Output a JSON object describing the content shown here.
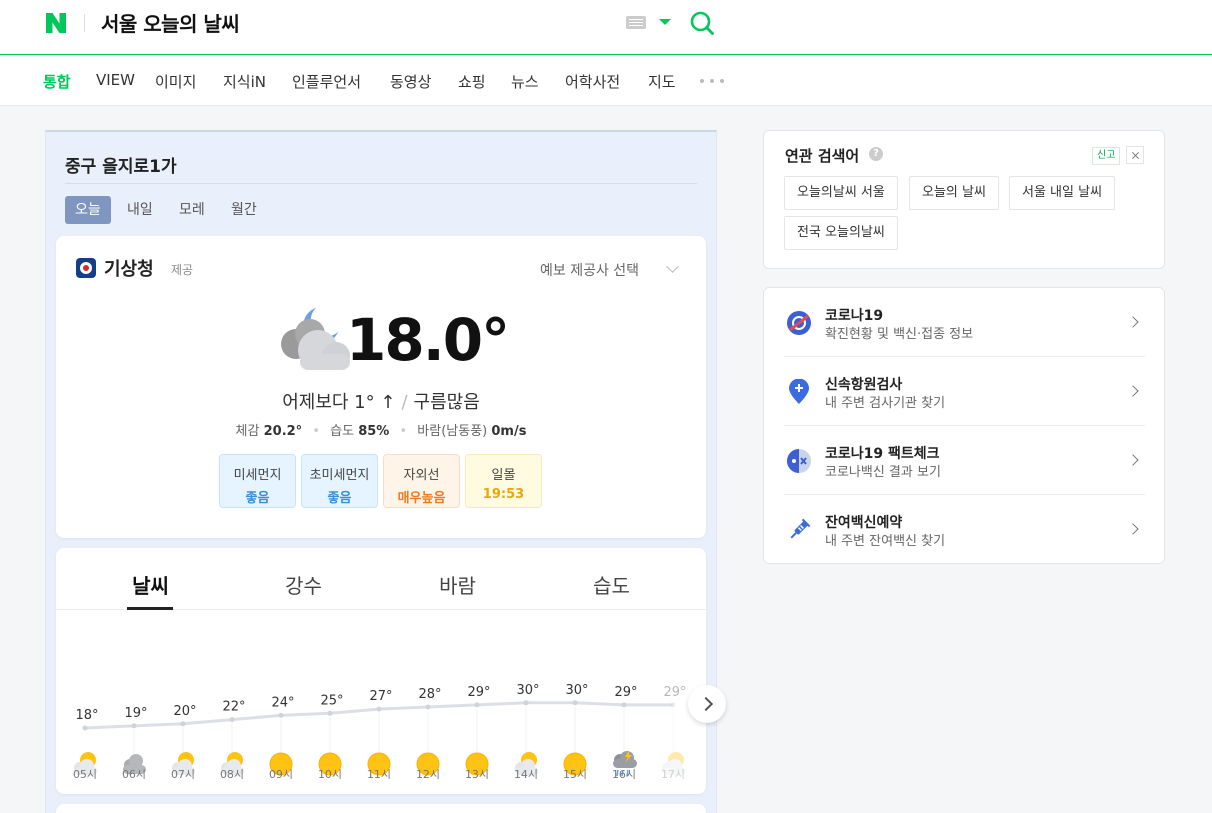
{
  "header": {
    "query": "서울 오늘의 날씨"
  },
  "nav": {
    "items": [
      "통합",
      "VIEW",
      "이미지",
      "지식iN",
      "인플루언서",
      "동영상",
      "쇼핑",
      "뉴스",
      "어학사전",
      "지도"
    ],
    "active_index": 0
  },
  "weather": {
    "location": "중구 을지로1가",
    "day_tabs": [
      "오늘",
      "내일",
      "모레",
      "월간"
    ],
    "active_day_index": 0,
    "provider": "기상청",
    "provider_sub": "제공",
    "provider_select": "예보 제공사 선택",
    "current_icon": "cloudy-night-icon",
    "temperature": "18.0°",
    "compare": "어제보다 1° ↑",
    "condition": "구름많음",
    "details": {
      "feels_label": "체감",
      "feels_value": "20.2°",
      "humidity_label": "습도",
      "humidity_value": "85%",
      "wind_label": "바람(남동풍)",
      "wind_value": "0m/s"
    },
    "badges": [
      {
        "label": "미세먼지",
        "value": "좋음",
        "tone": "blue"
      },
      {
        "label": "초미세먼지",
        "value": "좋음",
        "tone": "blue"
      },
      {
        "label": "자외선",
        "value": "매우높음",
        "tone": "orange"
      },
      {
        "label": "일몰",
        "value": "19:53",
        "tone": "yellow"
      }
    ],
    "chart_tabs": [
      "날씨",
      "강수",
      "바람",
      "습도"
    ],
    "active_chart_tab": 0,
    "hourly": [
      {
        "time": "05시",
        "temp": 18,
        "icon": "partly-cloudy-icon"
      },
      {
        "time": "06시",
        "temp": 19,
        "icon": "cloud-icon"
      },
      {
        "time": "07시",
        "temp": 20,
        "icon": "partly-cloudy-icon"
      },
      {
        "time": "08시",
        "temp": 22,
        "icon": "partly-cloudy-icon"
      },
      {
        "time": "09시",
        "temp": 24,
        "icon": "sun-icon"
      },
      {
        "time": "10시",
        "temp": 25,
        "icon": "sun-icon"
      },
      {
        "time": "11시",
        "temp": 27,
        "icon": "sun-icon"
      },
      {
        "time": "12시",
        "temp": 28,
        "icon": "sun-icon"
      },
      {
        "time": "13시",
        "temp": 29,
        "icon": "sun-icon"
      },
      {
        "time": "14시",
        "temp": 30,
        "icon": "partly-cloudy-icon"
      },
      {
        "time": "15시",
        "temp": 30,
        "icon": "sun-icon"
      },
      {
        "time": "16시",
        "temp": 29,
        "icon": "thunder-rain-icon"
      },
      {
        "time": "17시",
        "temp": 29,
        "icon": "partly-cloudy-icon"
      }
    ]
  },
  "related": {
    "title": "연관 검색어",
    "help": "?",
    "report": "신고",
    "keywords": [
      "오늘의날씨 서울",
      "오늘의 날씨",
      "서울 내일 날씨",
      "전국 오늘의날씨"
    ]
  },
  "covid": {
    "items": [
      {
        "title": "코로나19",
        "desc": "확진현황 및 백신·접종 정보",
        "icon": "no-virus-icon"
      },
      {
        "title": "신속항원검사",
        "desc": "내 주변 검사기관 찾기",
        "icon": "location-pin-icon"
      },
      {
        "title": "코로나19 팩트체크",
        "desc": "코로나백신 결과 보기",
        "icon": "fact-check-icon"
      },
      {
        "title": "잔여백신예약",
        "desc": "내 주변 잔여백신 찾기",
        "icon": "syringe-icon"
      }
    ]
  },
  "colors": {
    "brand": "#03c75a",
    "day_tab_active": "#7f96c1",
    "temp_line": "#dcdfe5"
  }
}
